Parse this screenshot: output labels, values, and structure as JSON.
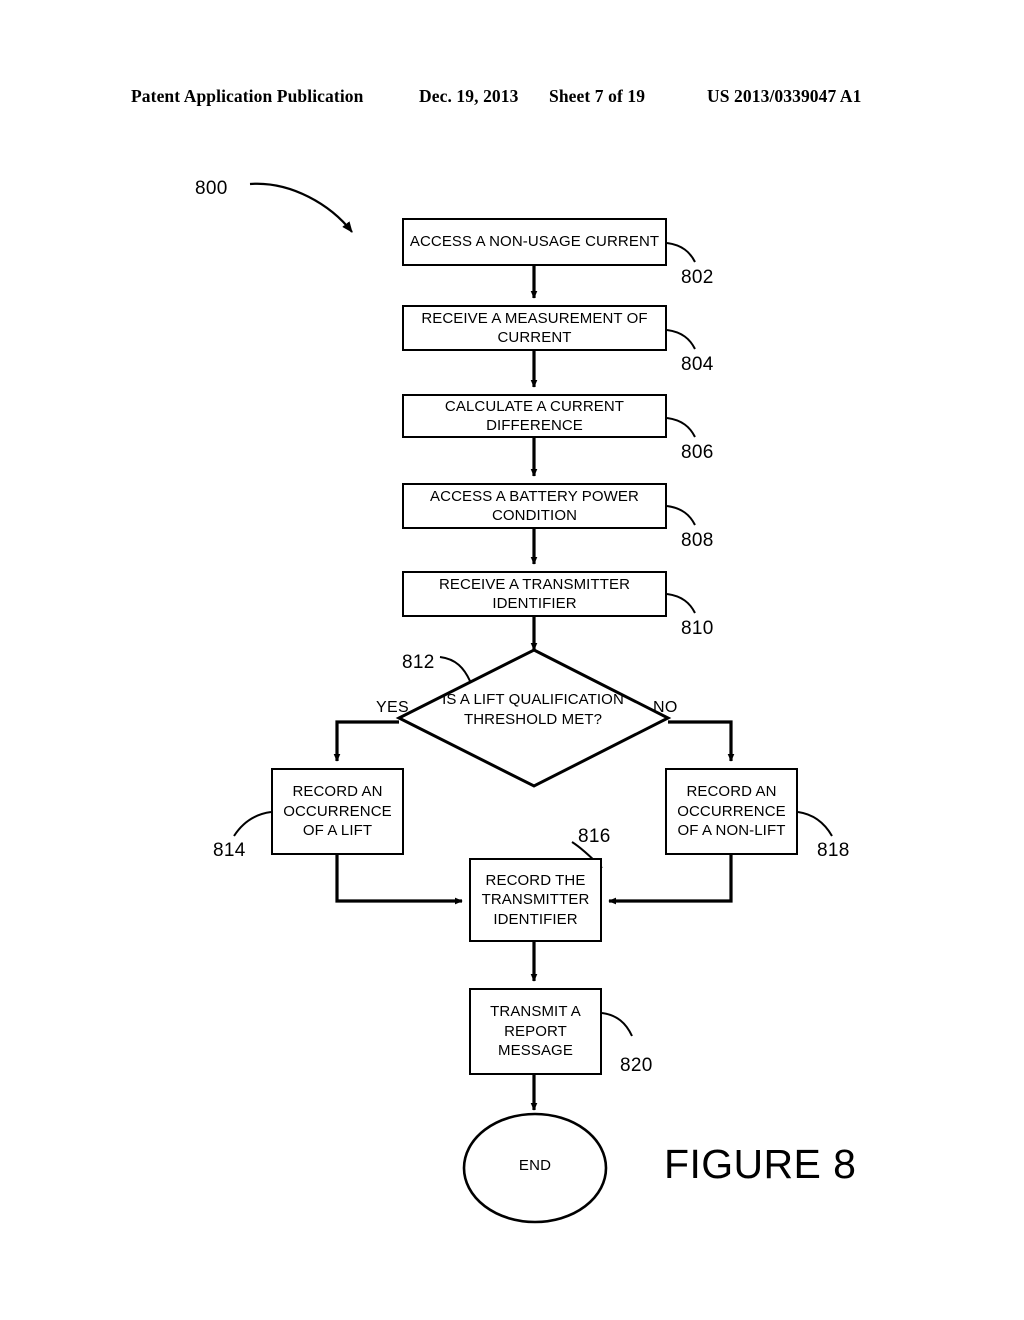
{
  "header": {
    "publication": "Patent Application Publication",
    "date": "Dec. 19, 2013",
    "sheet": "Sheet 7 of 19",
    "patent_number": "US 2013/0339047 A1"
  },
  "figure": {
    "caption": "FIGURE 8",
    "flow_label": "800",
    "nodes": [
      {
        "ref": "802",
        "text": "ACCESS A NON-USAGE CURRENT",
        "shape": "process"
      },
      {
        "ref": "804",
        "text": "RECEIVE A MEASUREMENT OF CURRENT",
        "shape": "process"
      },
      {
        "ref": "806",
        "text": "CALCULATE A CURRENT DIFFERENCE",
        "shape": "process"
      },
      {
        "ref": "808",
        "text": "ACCESS A BATTERY POWER CONDITION",
        "shape": "process"
      },
      {
        "ref": "810",
        "text": "RECEIVE A TRANSMITTER IDENTIFIER",
        "shape": "process"
      },
      {
        "ref": "812",
        "text": "IS A LIFT QUALIFICATION THRESHOLD MET?",
        "shape": "decision"
      },
      {
        "ref": "814",
        "text": "RECORD AN OCCURRENCE OF A LIFT",
        "shape": "process"
      },
      {
        "ref": "816",
        "text": "RECORD  THE TRANSMITTER IDENTIFIER",
        "shape": "process"
      },
      {
        "ref": "818",
        "text": "RECORD AN OCCURRENCE OF A NON-LIFT",
        "shape": "process"
      },
      {
        "ref": "820",
        "text": "TRANSMIT A REPORT MESSAGE",
        "shape": "process"
      },
      {
        "ref": "",
        "text": "END",
        "shape": "terminator"
      }
    ],
    "branches": {
      "yes": "YES",
      "no": "NO"
    },
    "stroke_color": "#000000",
    "fill_color": "#ffffff"
  }
}
